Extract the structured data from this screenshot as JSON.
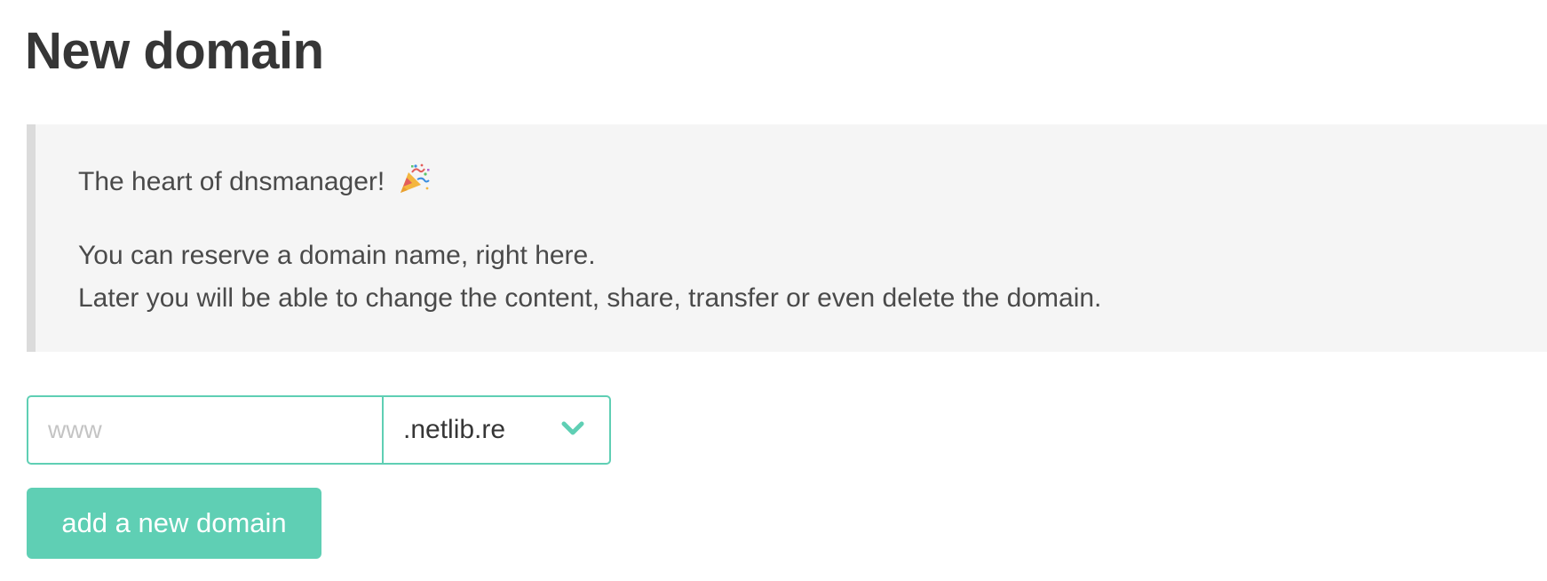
{
  "page": {
    "title": "New domain"
  },
  "notice": {
    "intro": "The heart of dnsmanager!",
    "intro_icon": "party-popper-icon",
    "line1": "You can reserve a domain name, right here.",
    "line2": "Later you will be able to change the content, share, transfer or even delete the domain."
  },
  "form": {
    "subdomain_placeholder": "www",
    "subdomain_value": "",
    "tld_selected": ".netlib.re",
    "submit_label": "add a new domain"
  },
  "colors": {
    "accent": "#5fcfb4",
    "notice_bg": "#f5f5f5",
    "notice_border": "#dbdbdb",
    "text": "#363636"
  }
}
